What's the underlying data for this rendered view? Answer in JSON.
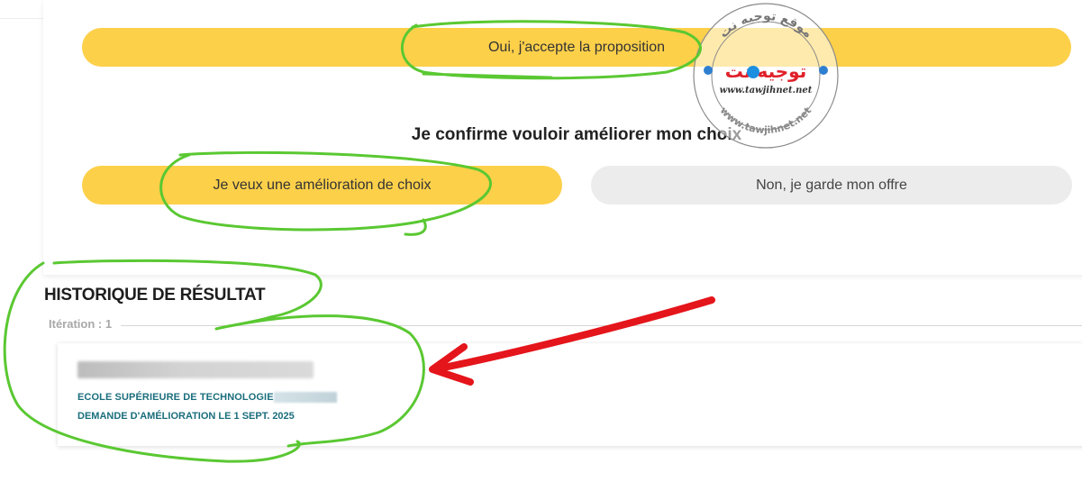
{
  "buttons": {
    "accept": "Oui, j'accepte la proposition",
    "improve": "Je veux une amélioration de choix",
    "keep": "Non, je garde mon offre"
  },
  "confirm_heading": "Je confirme vouloir améliorer mon choix",
  "history": {
    "title": "HISTORIQUE DE RÉSULTAT",
    "iteration_label": "Itération : 1",
    "result": {
      "school": "ECOLE SUPÉRIEURE DE TECHNOLOGIE",
      "request": "DEMANDE D'AMÉLIORATION LE 1 SEPT. 2025"
    }
  },
  "watermark": {
    "arabic_top": "موقع توجيه نت",
    "arabic_logo": "توجيه نت",
    "url": "www.tawjihnet.net",
    "ring_text": "www.tawjihnet.net"
  },
  "colors": {
    "primary_button": "#fdd04a",
    "secondary_button": "#ececec",
    "result_text": "#1a6e7c",
    "annotation_green": "#5ac832",
    "annotation_red": "#e4151b"
  }
}
